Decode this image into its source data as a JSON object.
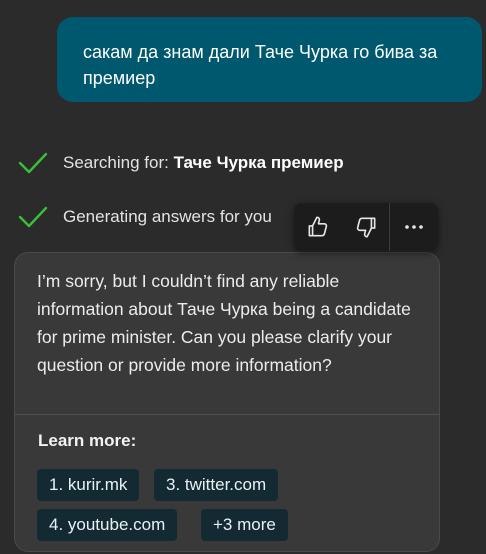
{
  "user_message": "сакам да знам дали Таче Чурка го бива за премиер",
  "status": {
    "searching_prefix": "Searching for: ",
    "searching_query": "Таче Чурка премиер",
    "generating": "Generating answers for you"
  },
  "toolbar": {
    "like_icon": "thumbs-up-icon",
    "dislike_icon": "thumbs-down-icon",
    "more_icon": "more-horizontal-icon"
  },
  "response": {
    "message": "I’m sorry, but I couldn’t find any reliable information about Таче Чурка being a candidate for prime minister. Can you please clarify your question or provide more information?",
    "learn_more_title": "Learn more:",
    "sources": [
      {
        "label": "1. kurir.mk"
      },
      {
        "label": "3. twitter.com"
      },
      {
        "label": "4. youtube.com"
      },
      {
        "label": "+3 more"
      }
    ]
  },
  "colors": {
    "background": "#2b2b2b",
    "user_bubble": "#00586f",
    "check_green": "#3bbf3b",
    "chip_bg": "#132a33"
  }
}
